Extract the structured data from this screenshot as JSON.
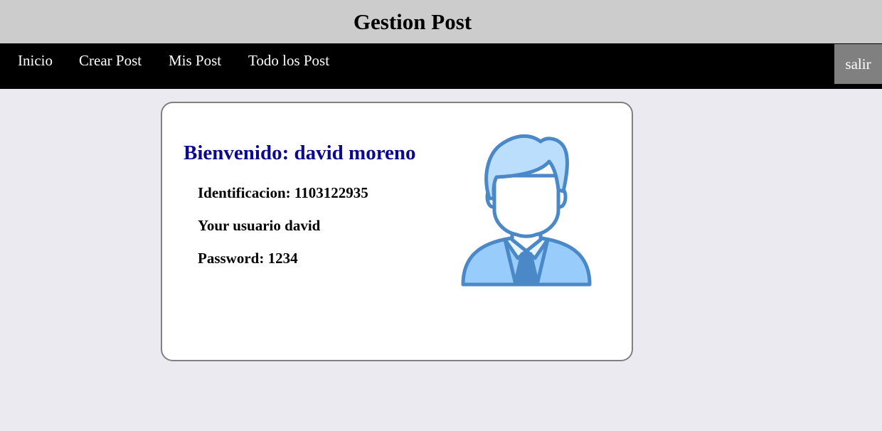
{
  "header": {
    "title": "Gestion Post"
  },
  "nav": {
    "items": [
      {
        "label": "Inicio"
      },
      {
        "label": "Crear Post"
      },
      {
        "label": "Mis Post"
      },
      {
        "label": "Todo los Post"
      }
    ],
    "logout_label": "salir"
  },
  "profile": {
    "welcome": "Bienvenido: david moreno",
    "identification": "Identificacion: 1103122935",
    "username": "Your usuario david",
    "password": "Password: 1234",
    "avatar_icon": "user-avatar-icon"
  },
  "colors": {
    "header_bg": "#cccccc",
    "nav_bg": "#000000",
    "logout_bg": "#808080",
    "page_bg": "#ebeaf0",
    "welcome_text": "#0c0a8c",
    "avatar_stroke": "#4a88c8",
    "avatar_fill": "#98ccfa"
  }
}
